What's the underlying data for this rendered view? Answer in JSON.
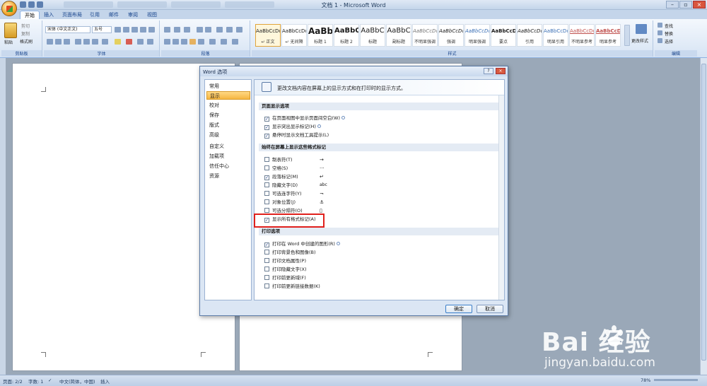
{
  "window": {
    "title": "文档 1 - Microsoft Word"
  },
  "tabs": [
    "开始",
    "插入",
    "页面布局",
    "引用",
    "邮件",
    "审阅",
    "视图"
  ],
  "ribbon": {
    "clipboard": {
      "paste": "粘贴",
      "cut": "剪切",
      "copy": "复制",
      "format_painter": "格式刷",
      "label": "剪贴板"
    },
    "font": {
      "name": "宋体 (中文正文)",
      "size": "五号",
      "label": "字体"
    },
    "paragraph": {
      "label": "段落"
    },
    "styles": {
      "label": "样式",
      "items": [
        {
          "preview": "AaBbCcDd",
          "name": "↵ 正文"
        },
        {
          "preview": "AaBbCcDd",
          "name": "↵ 无间隔"
        },
        {
          "preview": "AaBb",
          "name": "标题 1"
        },
        {
          "preview": "AaBbC",
          "name": "标题 2"
        },
        {
          "preview": "AaBbC",
          "name": "标题"
        },
        {
          "preview": "AaBbC",
          "name": "副标题"
        },
        {
          "preview": "AaBbCcDd",
          "name": "不明显强调"
        },
        {
          "preview": "AaBbCcDd",
          "name": "强调"
        },
        {
          "preview": "AaBbCcDd",
          "name": "明显强调"
        },
        {
          "preview": "AaBbCcDd",
          "name": "要点"
        },
        {
          "preview": "AaBbCcDd",
          "name": "引用"
        },
        {
          "preview": "AaBbCcDd",
          "name": "明显引用"
        },
        {
          "preview": "AaBbCcDd",
          "name": "不明显参考"
        },
        {
          "preview": "AaBbCcDd",
          "name": "明显参考"
        }
      ],
      "change_styles": "更改样式"
    },
    "editing": {
      "find": "查找",
      "replace": "替换",
      "select": "选择",
      "label": "编辑"
    }
  },
  "dialog": {
    "title": "Word 选项",
    "nav": [
      "常用",
      "显示",
      "校对",
      "保存",
      "版式",
      "高级",
      "自定义",
      "加载项",
      "信任中心",
      "资源"
    ],
    "active_nav": "显示",
    "banner": "更改文档内容在屏幕上的显示方式和在打印时的显示方式。",
    "sections": {
      "page_display": {
        "title": "页面显示选项",
        "options": [
          {
            "label": "在页面视图中显示页面间空白(W)",
            "checked": true
          },
          {
            "label": "显示突出显示标记(H)",
            "checked": true
          },
          {
            "label": "悬停时显示文档工具提示(L)",
            "checked": true
          }
        ]
      },
      "formatting_marks": {
        "title": "始终在屏幕上显示这些格式标记",
        "options": [
          {
            "label": "制表符(T)",
            "symbol": "→",
            "checked": false
          },
          {
            "label": "空格(S)",
            "symbol": "···",
            "checked": false
          },
          {
            "label": "段落标记(M)",
            "symbol": "↵",
            "checked": true
          },
          {
            "label": "隐藏文字(D)",
            "symbol": "abc",
            "checked": false
          },
          {
            "label": "可选连字符(Y)",
            "symbol": "¬",
            "checked": false
          },
          {
            "label": "对象位置(J)",
            "symbol": "⚓",
            "checked": false
          },
          {
            "label": "可选分隔符(O)",
            "symbol": "▯",
            "checked": false
          },
          {
            "label": "显示所有格式标记(A)",
            "checked": true
          }
        ]
      },
      "print": {
        "title": "打印选项",
        "options": [
          {
            "label": "打印在 Word 中创建的图形(R)",
            "checked": true
          },
          {
            "label": "打印背景色和图像(B)",
            "checked": false
          },
          {
            "label": "打印文档属性(P)",
            "checked": false
          },
          {
            "label": "打印隐藏文字(X)",
            "checked": false
          },
          {
            "label": "打印前更新域(F)",
            "checked": false
          },
          {
            "label": "打印前更新链接数据(K)",
            "checked": false
          }
        ]
      }
    },
    "ok": "确定",
    "cancel": "取消"
  },
  "status": {
    "page": "页面: 2/2",
    "words": "字数: 1",
    "language": "中文(简体，中国)",
    "mode": "插入",
    "zoom": "78%"
  },
  "watermark": {
    "main": "Bai  经验",
    "sub": "jingyan.baidu.com"
  }
}
